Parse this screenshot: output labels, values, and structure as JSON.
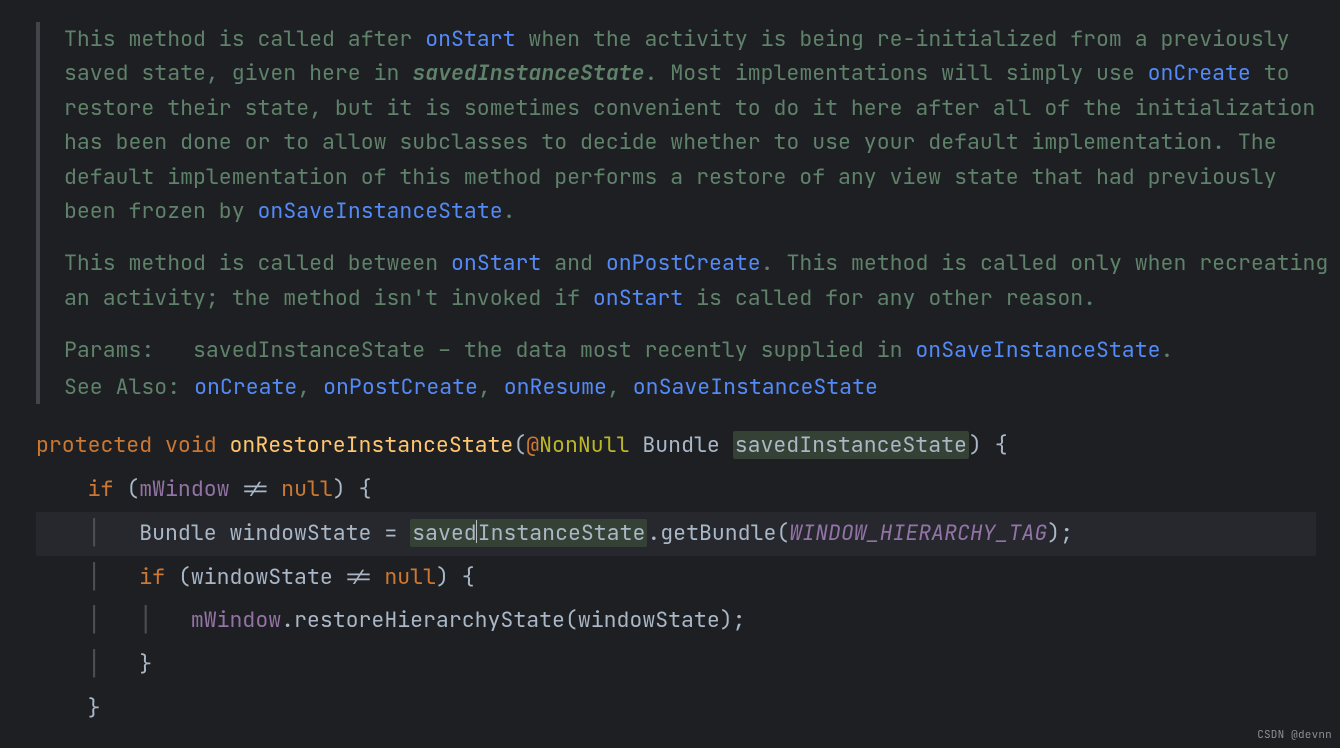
{
  "doc": {
    "p1_a": "This method is called after ",
    "p1_link1": "onStart",
    "p1_b": " when the activity is being re-initialized from a previously saved state, given here in ",
    "p1_em": "savedInstanceState",
    "p1_c": ". Most implementations will simply use ",
    "p1_link2": "onCreate",
    "p1_d": " to restore their state, but it is sometimes convenient to do it here after all of the initialization has been done or to allow subclasses to decide whether to use your default implementation. The default implementation of this method performs a restore of any view state that had previously been frozen by ",
    "p1_link3": "onSaveInstanceState",
    "p1_e": ".",
    "p2_a": "This method is called between ",
    "p2_link1": "onStart",
    "p2_b": " and ",
    "p2_link2": "onPostCreate",
    "p2_c": ". This method is called only when recreating an activity; the method isn't invoked if ",
    "p2_link3": "onStart",
    "p2_d": " is called for any other reason.",
    "params_label": "Params:",
    "params_name": "savedInstanceState",
    "params_sep": " – the data most recently supplied in ",
    "params_link": "onSaveInstanceState",
    "params_dot": ".",
    "seealso_label": "See Also:",
    "seealso_sep": ", ",
    "seealso": [
      "onCreate",
      "onPostCreate",
      "onResume",
      "onSaveInstanceState"
    ]
  },
  "code": {
    "protected": "protected",
    "void": "void",
    "method": "onRestoreInstanceState",
    "at": "@",
    "nonnull": "NonNull",
    "bundle": "Bundle",
    "param": "savedInstanceState",
    "if": "if",
    "mwindow": "mWindow",
    "bundle2": "Bundle",
    "windowstate": "windowState",
    "getbundle": ".getBundle(",
    "const": "WINDOW_HIERARCHY_TAG",
    "restore": ".restoreHierarchyState(",
    "null": "null"
  },
  "watermark": "CSDN @devnn"
}
